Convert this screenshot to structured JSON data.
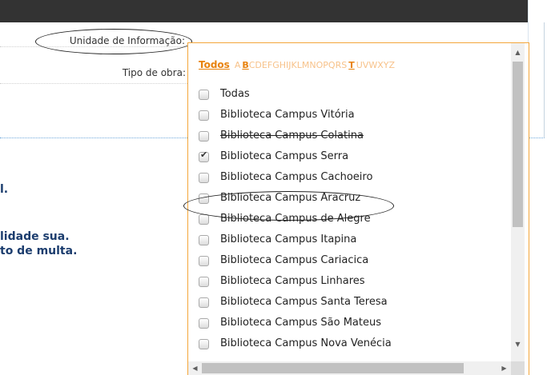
{
  "form": {
    "unidade_label": "Unidade de Informação:",
    "tipo_label": "Tipo de obra:"
  },
  "background_text": {
    "line1": "l.",
    "line2": "lidade sua.",
    "line3": "to de multa."
  },
  "dropdown": {
    "filter": {
      "todos": "Todos",
      "letters": [
        "A",
        "B",
        "C",
        "D",
        "E",
        "F",
        "G",
        "H",
        "I",
        "J",
        "K",
        "L",
        "M",
        "N",
        "O",
        "P",
        "Q",
        "R",
        "S",
        "T",
        "U",
        "V",
        "W",
        "X",
        "Y",
        "Z"
      ],
      "active_letters": [
        "B",
        "T"
      ]
    },
    "items": [
      {
        "label": "Todas",
        "checked": false
      },
      {
        "label": "Biblioteca Campus Vitória",
        "checked": false
      },
      {
        "label": "Biblioteca Campus Colatina",
        "checked": false
      },
      {
        "label": "Biblioteca Campus Serra",
        "checked": true
      },
      {
        "label": "Biblioteca Campus Cachoeiro",
        "checked": false
      },
      {
        "label": "Biblioteca Campus Aracruz",
        "checked": false
      },
      {
        "label": "Biblioteca Campus de Alegre",
        "checked": false
      },
      {
        "label": "Biblioteca Campus Itapina",
        "checked": false
      },
      {
        "label": "Biblioteca Campus Cariacica",
        "checked": false
      },
      {
        "label": "Biblioteca Campus Linhares",
        "checked": false
      },
      {
        "label": "Biblioteca Campus Santa Teresa",
        "checked": false
      },
      {
        "label": "Biblioteca Campus São Mateus",
        "checked": false
      },
      {
        "label": "Biblioteca Campus Nova Venécia",
        "checked": false
      }
    ]
  },
  "icons": {
    "scroll_up": "triangle-up",
    "scroll_down": "triangle-down",
    "scroll_left": "triangle-left",
    "scroll_right": "triangle-right",
    "checkmark": "check"
  },
  "colors": {
    "accent": "#e8820c",
    "accent_light": "#f7c28a",
    "dropdown_border": "#f4a63a",
    "topbar": "#333333",
    "bg_text": "#1c3d6e"
  }
}
